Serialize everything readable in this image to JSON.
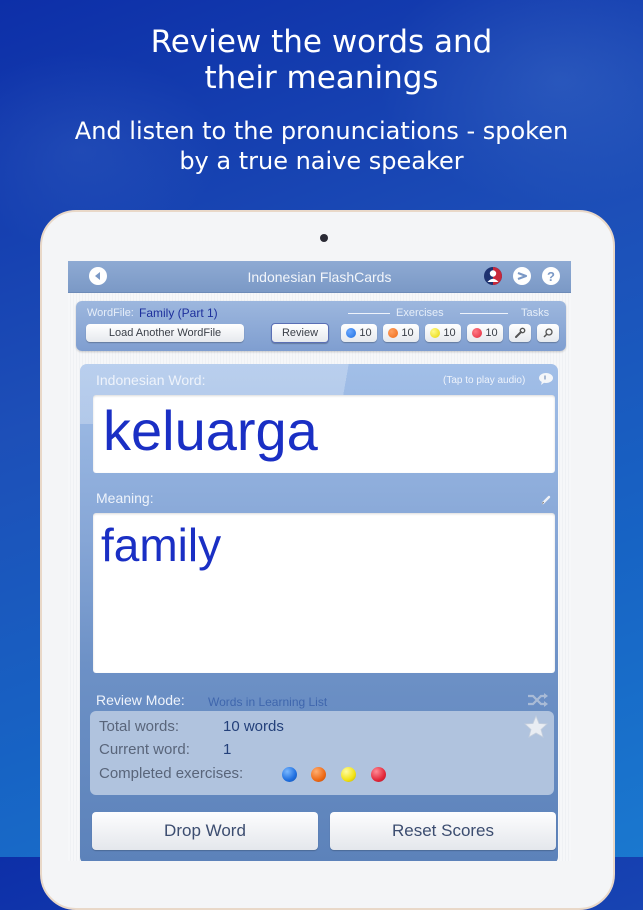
{
  "promo": {
    "headline": [
      "Review the words and",
      "their meanings"
    ],
    "subheadline": [
      "And listen to the pronunciations - spoken",
      "by a true naive speaker"
    ]
  },
  "navbar": {
    "title": "Indonesian FlashCards",
    "icons": [
      "back-icon",
      "user-icon",
      "share-icon",
      "help-icon"
    ]
  },
  "toolbar": {
    "wordfile_label": "WordFile:",
    "wordfile_value": "Family (Part 1)",
    "load_button": "Load Another WordFile",
    "review_button": "Review",
    "exercises_label": "Exercises",
    "tasks_label": "Tasks",
    "exercises": [
      {
        "color": "#1f6fe0",
        "count": "10"
      },
      {
        "color": "#ee6a16",
        "count": "10"
      },
      {
        "color": "#f2e214",
        "count": "10"
      },
      {
        "color": "#e3283a",
        "count": "10"
      }
    ],
    "task_icons": [
      "wrench-icon",
      "search-icon"
    ]
  },
  "card": {
    "word_label": "Indonesian Word:",
    "audio_hint": "(Tap to play audio)",
    "word": "keluarga",
    "meaning_label": "Meaning:",
    "meaning": "family",
    "review_mode_label": "Review Mode:",
    "review_mode_value": "Words in Learning List",
    "stats": {
      "total_label": "Total words:",
      "total_value": "10 words",
      "current_label": "Current word:",
      "current_value": "1",
      "completed_label": "Completed exercises:",
      "completed_colors": [
        "#1f6fe0",
        "#ee6a16",
        "#f2e214",
        "#e3283a"
      ]
    }
  },
  "actions": {
    "drop_word": "Drop Word",
    "reset_scores": "Reset Scores"
  }
}
